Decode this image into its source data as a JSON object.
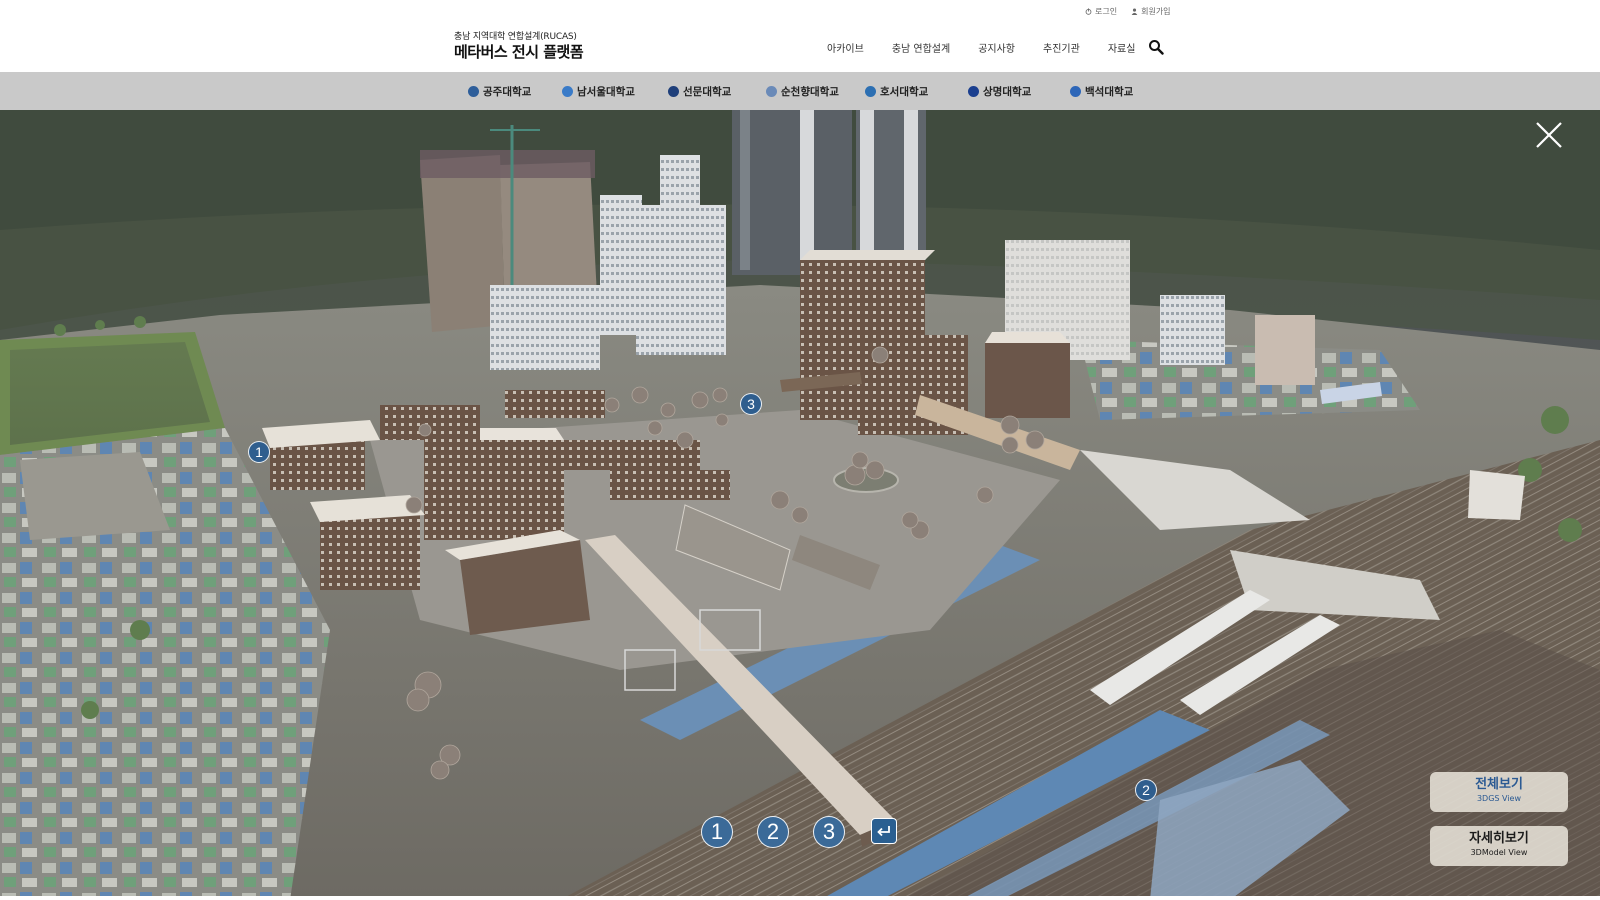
{
  "header": {
    "util": {
      "login": "로그인",
      "signup": "회원가입"
    },
    "logo": {
      "subtitle": "충남 지역대학 연합설계(RUCAS)",
      "title": "메타버스 전시 플랫폼"
    },
    "nav": [
      "아카이브",
      "충남 연합설계",
      "공지사항",
      "추진기관",
      "자료실"
    ],
    "icons": {
      "search": "search-icon",
      "login": "power-icon",
      "signup": "user-icon"
    }
  },
  "universities": [
    {
      "label": "공주대학교",
      "emblem_color": "#2e5e9a"
    },
    {
      "label": "남서울대학교",
      "emblem_color": "#3a7bc8"
    },
    {
      "label": "선문대학교",
      "emblem_color": "#1f3f7a"
    },
    {
      "label": "순천향대학교",
      "emblem_color": "#6a8ab8"
    },
    {
      "label": "호서대학교",
      "emblem_color": "#2c6fb2"
    },
    {
      "label": "상명대학교",
      "emblem_color": "#1b3f8f"
    },
    {
      "label": "백석대학교",
      "emblem_color": "#2d66b8"
    }
  ],
  "scene": {
    "markers": [
      "1",
      "3",
      "2"
    ],
    "bottom_nav": [
      "1",
      "2",
      "3"
    ],
    "return_icon": "return-arrow-icon",
    "close_icon": "close-icon"
  },
  "view_buttons": {
    "full": {
      "title": "전체보기",
      "subtitle": "3DGS View"
    },
    "detail": {
      "title": "자세히보기",
      "subtitle": "3DModel View"
    }
  },
  "colors": {
    "marker": "#2f5e8e",
    "accent": "#2b5a93",
    "unibar": "#c9c9c9"
  }
}
